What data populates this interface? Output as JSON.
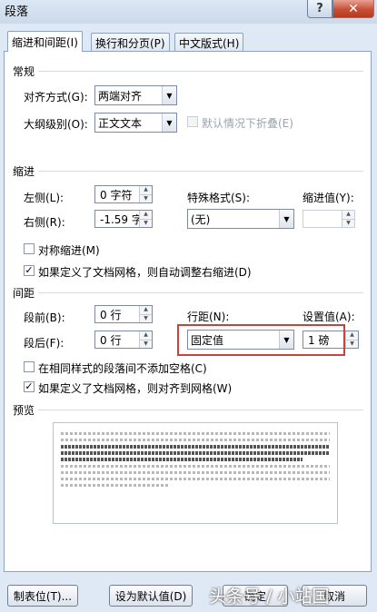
{
  "window": {
    "title": "段落",
    "help_glyph": "?",
    "close_glyph": "✕"
  },
  "tabs": [
    {
      "label": "缩进和间距(I)",
      "active": true
    },
    {
      "label": "换行和分页(P)",
      "active": false
    },
    {
      "label": "中文版式(H)",
      "active": false
    }
  ],
  "general": {
    "heading": "常规",
    "alignment_label": "对齐方式(G):",
    "alignment_value": "两端对齐",
    "outline_label": "大纲级别(O):",
    "outline_value": "正文文本",
    "collapse_label": "默认情况下折叠(E)"
  },
  "indent": {
    "heading": "缩进",
    "left_label": "左侧(L):",
    "left_value": "0 字符",
    "right_label": "右侧(R):",
    "right_value": "-1.59 字",
    "special_label": "特殊格式(S):",
    "special_value": "(无)",
    "indent_by_label": "缩进值(Y):",
    "indent_by_value": "",
    "mirror_label": "对称缩进(M)",
    "auto_adjust_label": "如果定义了文档网格，则自动调整右缩进(D)"
  },
  "spacing": {
    "heading": "间距",
    "before_label": "段前(B):",
    "before_value": "0 行",
    "after_label": "段后(F):",
    "after_value": "0 行",
    "line_spacing_label": "行距(N):",
    "line_spacing_value": "固定值",
    "at_label": "设置值(A):",
    "at_value": "1 磅",
    "no_space_label": "在相同样式的段落间不添加空格(C)",
    "snap_grid_label": "如果定义了文档网格，则对齐到网格(W)"
  },
  "preview": {
    "heading": "预览"
  },
  "buttons": {
    "tabs": "制表位(T)...",
    "set_default": "设为默认值(D)",
    "ok": "确定",
    "cancel": "取消"
  },
  "watermark": "头条号 / 小站国"
}
